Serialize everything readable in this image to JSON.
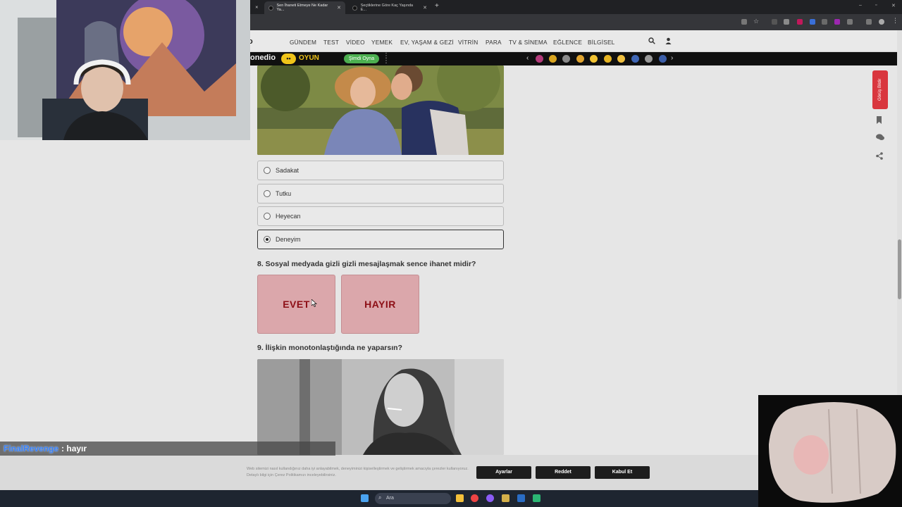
{
  "browser": {
    "tabs": [
      {
        "title": "Sen İhaneti Etmeye Ne Kadar Ya...",
        "active": true
      },
      {
        "title": "Seçtiklerine Göre Kaç Yaşında E...",
        "active": false
      }
    ],
    "window_controls": [
      "–",
      "▫",
      "✕"
    ]
  },
  "site": {
    "nav": [
      "GÜNDEM",
      "TEST",
      "VİDEO",
      "YEMEK",
      "EV, YAŞAM & GEZİ",
      "VİTRİN",
      "PARA",
      "TV & SİNEMA",
      "EĞLENCE",
      "BİLGİSEL"
    ],
    "gamebar": {
      "brand": "onedio",
      "brand_face": "••",
      "section": "OYUN",
      "play_label": "Şimdi Oyna",
      "prev": "‹",
      "next": "›"
    },
    "feedback_label": "Görüş Bildir"
  },
  "quiz": {
    "q7_options": [
      {
        "label": "Sadakat",
        "selected": false
      },
      {
        "label": "Tutku",
        "selected": false
      },
      {
        "label": "Heyecan",
        "selected": false
      },
      {
        "label": "Deneyim",
        "selected": true
      }
    ],
    "q8": {
      "question": "8. Sosyal medyada gizli gizli mesajlaşmak sence ihanet midir?",
      "yes": "EVET",
      "no": "HAYIR"
    },
    "q9": {
      "question": "9. İlişkin monotonlaştığında ne yaparsın?"
    }
  },
  "cookie": {
    "text": "Web sitemizi nasıl kullandığınız daha iyi anlayabilmek, deneyiminizi kişiselleştirmek ve geliştirmek amacıyla çerezler kullanıyoruz. Detaylı bilgi için Çerez Politikamızı inceleyebilirsiniz.",
    "settings": "Ayarlar",
    "reject": "Reddet",
    "accept": "Kabul Et"
  },
  "taskbar": {
    "search_placeholder": "Ara"
  },
  "chat": {
    "user": "FinalRevenge",
    "message": ": hayır"
  },
  "colors": {
    "accent_red": "#8d0f16",
    "answer_bg": "#dba7ab",
    "game_yellow": "#f0c419",
    "play_green": "#4caf50"
  }
}
